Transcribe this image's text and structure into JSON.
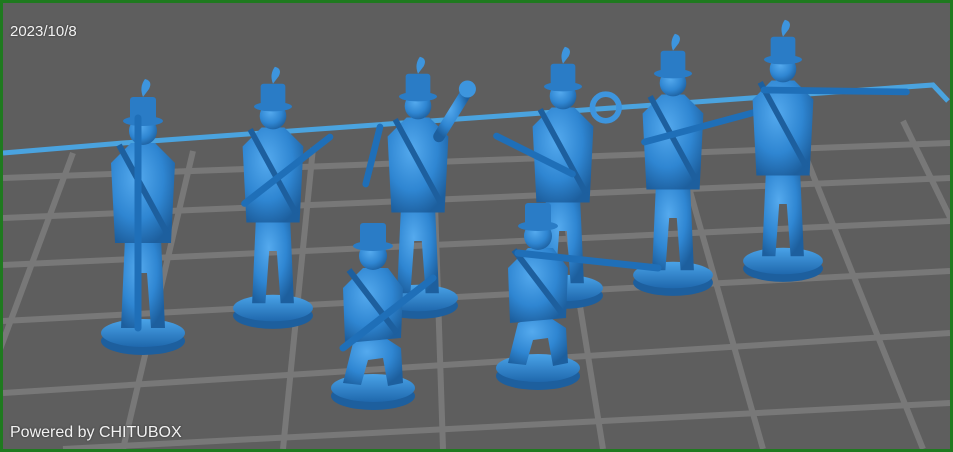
{
  "viewer": {
    "date": "2023/10/8",
    "watermark": "Powered by CHITUBOX"
  },
  "colors": {
    "frame": "#1f7a1f",
    "background": "#5e5e5e",
    "grid": "#7a7a7a",
    "platform_edge": "#4aa3df",
    "model": "#2f86d2",
    "model_shadow": "#1d5f9e",
    "model_highlight": "#4fa6ea"
  },
  "models": [
    {
      "name": "standing-musket-figure"
    },
    {
      "name": "marching-musket-figure"
    },
    {
      "name": "raised-fist-figure"
    },
    {
      "name": "kneeling-loading-figure"
    },
    {
      "name": "bugler-figure"
    },
    {
      "name": "kneeling-aiming-figure"
    },
    {
      "name": "ready-musket-figure"
    },
    {
      "name": "firing-musket-figure"
    }
  ]
}
